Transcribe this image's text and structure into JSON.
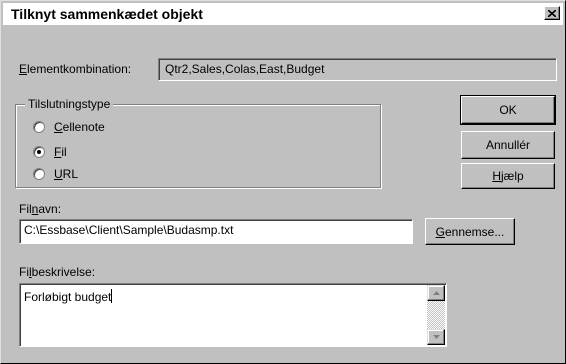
{
  "window": {
    "title": "Tilknyt sammenkædet objekt",
    "close_icon": "close-icon"
  },
  "member_combination": {
    "label_accel": "E",
    "label_rest": "lementkombination:",
    "value": "Qtr2,Sales,Colas,East,Budget"
  },
  "connection_type": {
    "legend": "Tilslutningstype",
    "options": [
      {
        "accel": "C",
        "rest": "ellenote",
        "checked": false
      },
      {
        "accel": "F",
        "rest": "il",
        "checked": true
      },
      {
        "accel": "U",
        "rest": "RL",
        "checked": false
      }
    ]
  },
  "buttons": {
    "ok": "OK",
    "cancel": "Annullér",
    "help_accel": "H",
    "help_rest": "jælp",
    "browse_accel": "G",
    "browse_rest": "ennemse..."
  },
  "file_name": {
    "label_pre": "Fil",
    "label_accel": "n",
    "label_post": "avn:",
    "value": "C:\\Essbase\\Client\\Sample\\Budasmp.txt"
  },
  "file_description": {
    "label_pre": "Fi",
    "label_accel": "l",
    "label_post": "beskrivelse:",
    "value": "Forløbigt budget"
  }
}
